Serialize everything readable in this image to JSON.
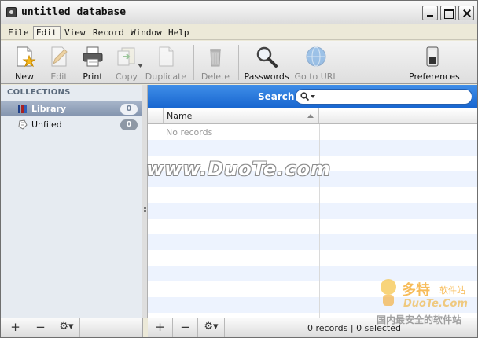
{
  "window": {
    "title": "untitled database"
  },
  "menu": [
    {
      "label": "File",
      "active": false
    },
    {
      "label": "Edit",
      "active": true
    },
    {
      "label": "View",
      "active": false
    },
    {
      "label": "Record",
      "active": false
    },
    {
      "label": "Window",
      "active": false
    },
    {
      "label": "Help",
      "active": false
    }
  ],
  "toolbar": {
    "new": "New",
    "edit": "Edit",
    "print": "Print",
    "copy": "Copy",
    "duplicate": "Duplicate",
    "delete": "Delete",
    "passwords": "Passwords",
    "go_to_url": "Go to URL",
    "preferences": "Preferences"
  },
  "sidebar": {
    "section_title": "COLLECTIONS",
    "items": [
      {
        "label": "Library",
        "count": "0",
        "icon": "library-books-icon"
      },
      {
        "label": "Unfiled",
        "count": "0",
        "icon": "unfiled-icon"
      }
    ]
  },
  "search": {
    "label": "Search",
    "value": ""
  },
  "table": {
    "columns": [
      "Name"
    ],
    "empty_text": "No records"
  },
  "status": {
    "text": "0 records | 0 selected"
  },
  "bottom_left": {
    "add": "+",
    "remove": "−",
    "gear": "⚙▾"
  },
  "bottom_right": {
    "add": "+",
    "remove": "−",
    "gear": "⚙▾"
  },
  "watermark": {
    "main": "www.DuoTe.com",
    "brand_zh": "多特",
    "brand_zh_small": "软件站",
    "brand_domain": "DuoTe.Com",
    "slogan": "国内最安全的软件站"
  },
  "colors": {
    "search_bar": "#1f6fd9",
    "selection": "#8d9db5",
    "alt_row": "#edf3fe"
  }
}
